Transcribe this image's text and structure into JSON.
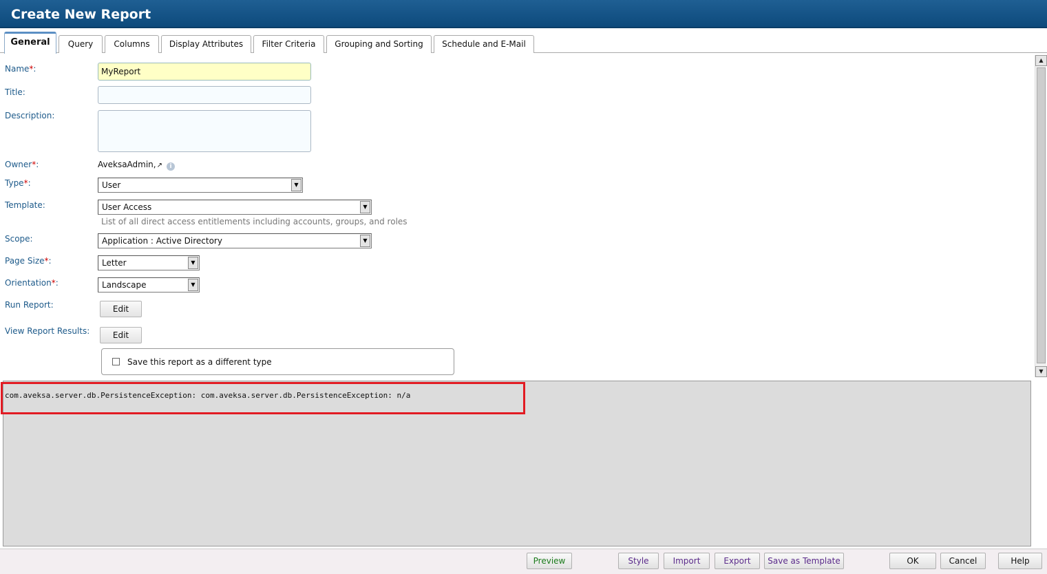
{
  "window": {
    "title": "Create New Report"
  },
  "tabs": [
    {
      "label": "General",
      "active": true
    },
    {
      "label": "Query"
    },
    {
      "label": "Columns"
    },
    {
      "label": "Display Attributes"
    },
    {
      "label": "Filter Criteria"
    },
    {
      "label": "Grouping and Sorting"
    },
    {
      "label": "Schedule and E-Mail"
    }
  ],
  "form": {
    "name_label": "Name",
    "name_value": "MyReport",
    "title_label": "Title:",
    "title_value": "",
    "description_label": "Description:",
    "description_value": "",
    "owner_label": "Owner",
    "owner_value": "AveksaAdmin,",
    "type_label": "Type",
    "type_value": "User",
    "template_label": "Template:",
    "template_value": "User Access",
    "template_hint": "List of all direct access entitlements including accounts, groups, and roles",
    "scope_label": "Scope:",
    "scope_value": "Application : Active Directory",
    "page_size_label": "Page Size",
    "page_size_value": "Letter",
    "orientation_label": "Orientation",
    "orientation_value": "Landscape",
    "run_report_label": "Run Report:",
    "view_results_label": "View Report Results:",
    "edit_label": "Edit",
    "save_different_type_label": "Save this report as a different type",
    "required_marker": "*",
    "colon": ":"
  },
  "console": {
    "message": "com.aveksa.server.db.PersistenceException: com.aveksa.server.db.PersistenceException: n/a"
  },
  "footer": {
    "preview": "Preview",
    "style": "Style",
    "import": "Import",
    "export": "Export",
    "save_as_template": "Save as Template",
    "ok": "OK",
    "cancel": "Cancel",
    "help": "Help"
  },
  "colors": {
    "titlebar": "#0d4a7c",
    "label": "#1d5a8a",
    "highlight_box": "#e21b23"
  }
}
